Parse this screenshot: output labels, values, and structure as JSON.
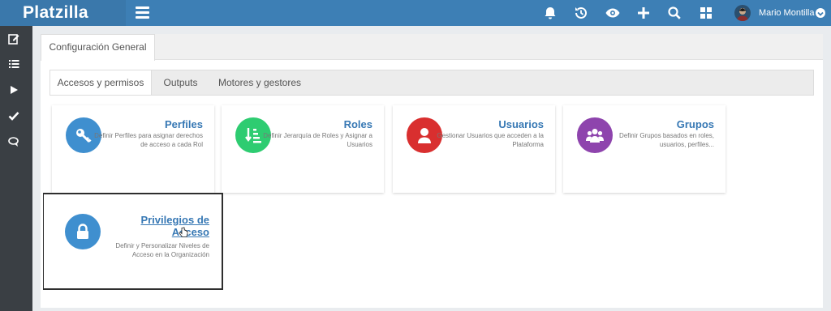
{
  "app": {
    "name": "Platzilla"
  },
  "topbar": {
    "icons": [
      "bell-icon",
      "history-icon",
      "eye-icon",
      "plus-icon",
      "search-icon",
      "grid-icon"
    ],
    "user_name": "Mario Montilla"
  },
  "sidebar": {
    "icons": [
      "edit-icon",
      "list-icon",
      "play-icon",
      "check-icon",
      "chat-icon"
    ]
  },
  "main": {
    "tab_label": "Configuración General",
    "subtabs": [
      {
        "label": "Accesos y permisos"
      },
      {
        "label": "Outputs"
      },
      {
        "label": "Motores y gestores"
      }
    ],
    "cards": [
      {
        "title": "Perfiles",
        "description": "Definir Perfiles para asignar derechos de acceso a cada Rol",
        "icon": "key-icon",
        "color": "#3f8fcf"
      },
      {
        "title": "Roles",
        "description": "Definir Jerarquía de Roles y Asignar a Usuarios",
        "icon": "sort-icon",
        "color": "#2ecc71"
      },
      {
        "title": "Usuarios",
        "description": "Gestionar Usuarios que acceden a la Plataforma",
        "icon": "user-icon",
        "color": "#d92f2f"
      },
      {
        "title": "Grupos",
        "description": "Definir Grupos basados en roles, usuarios, perfiles...",
        "icon": "group-icon",
        "color": "#8e44ad"
      },
      {
        "title": "Privilegios de Acceso",
        "description": "Definir y Personalizar Niveles de Acceso en la Organización",
        "icon": "lock-icon",
        "color": "#3f8fcf"
      }
    ]
  },
  "colors": {
    "topbar": "#3d7fb5",
    "sidebar": "#3a3f44",
    "link": "#3778b4"
  }
}
